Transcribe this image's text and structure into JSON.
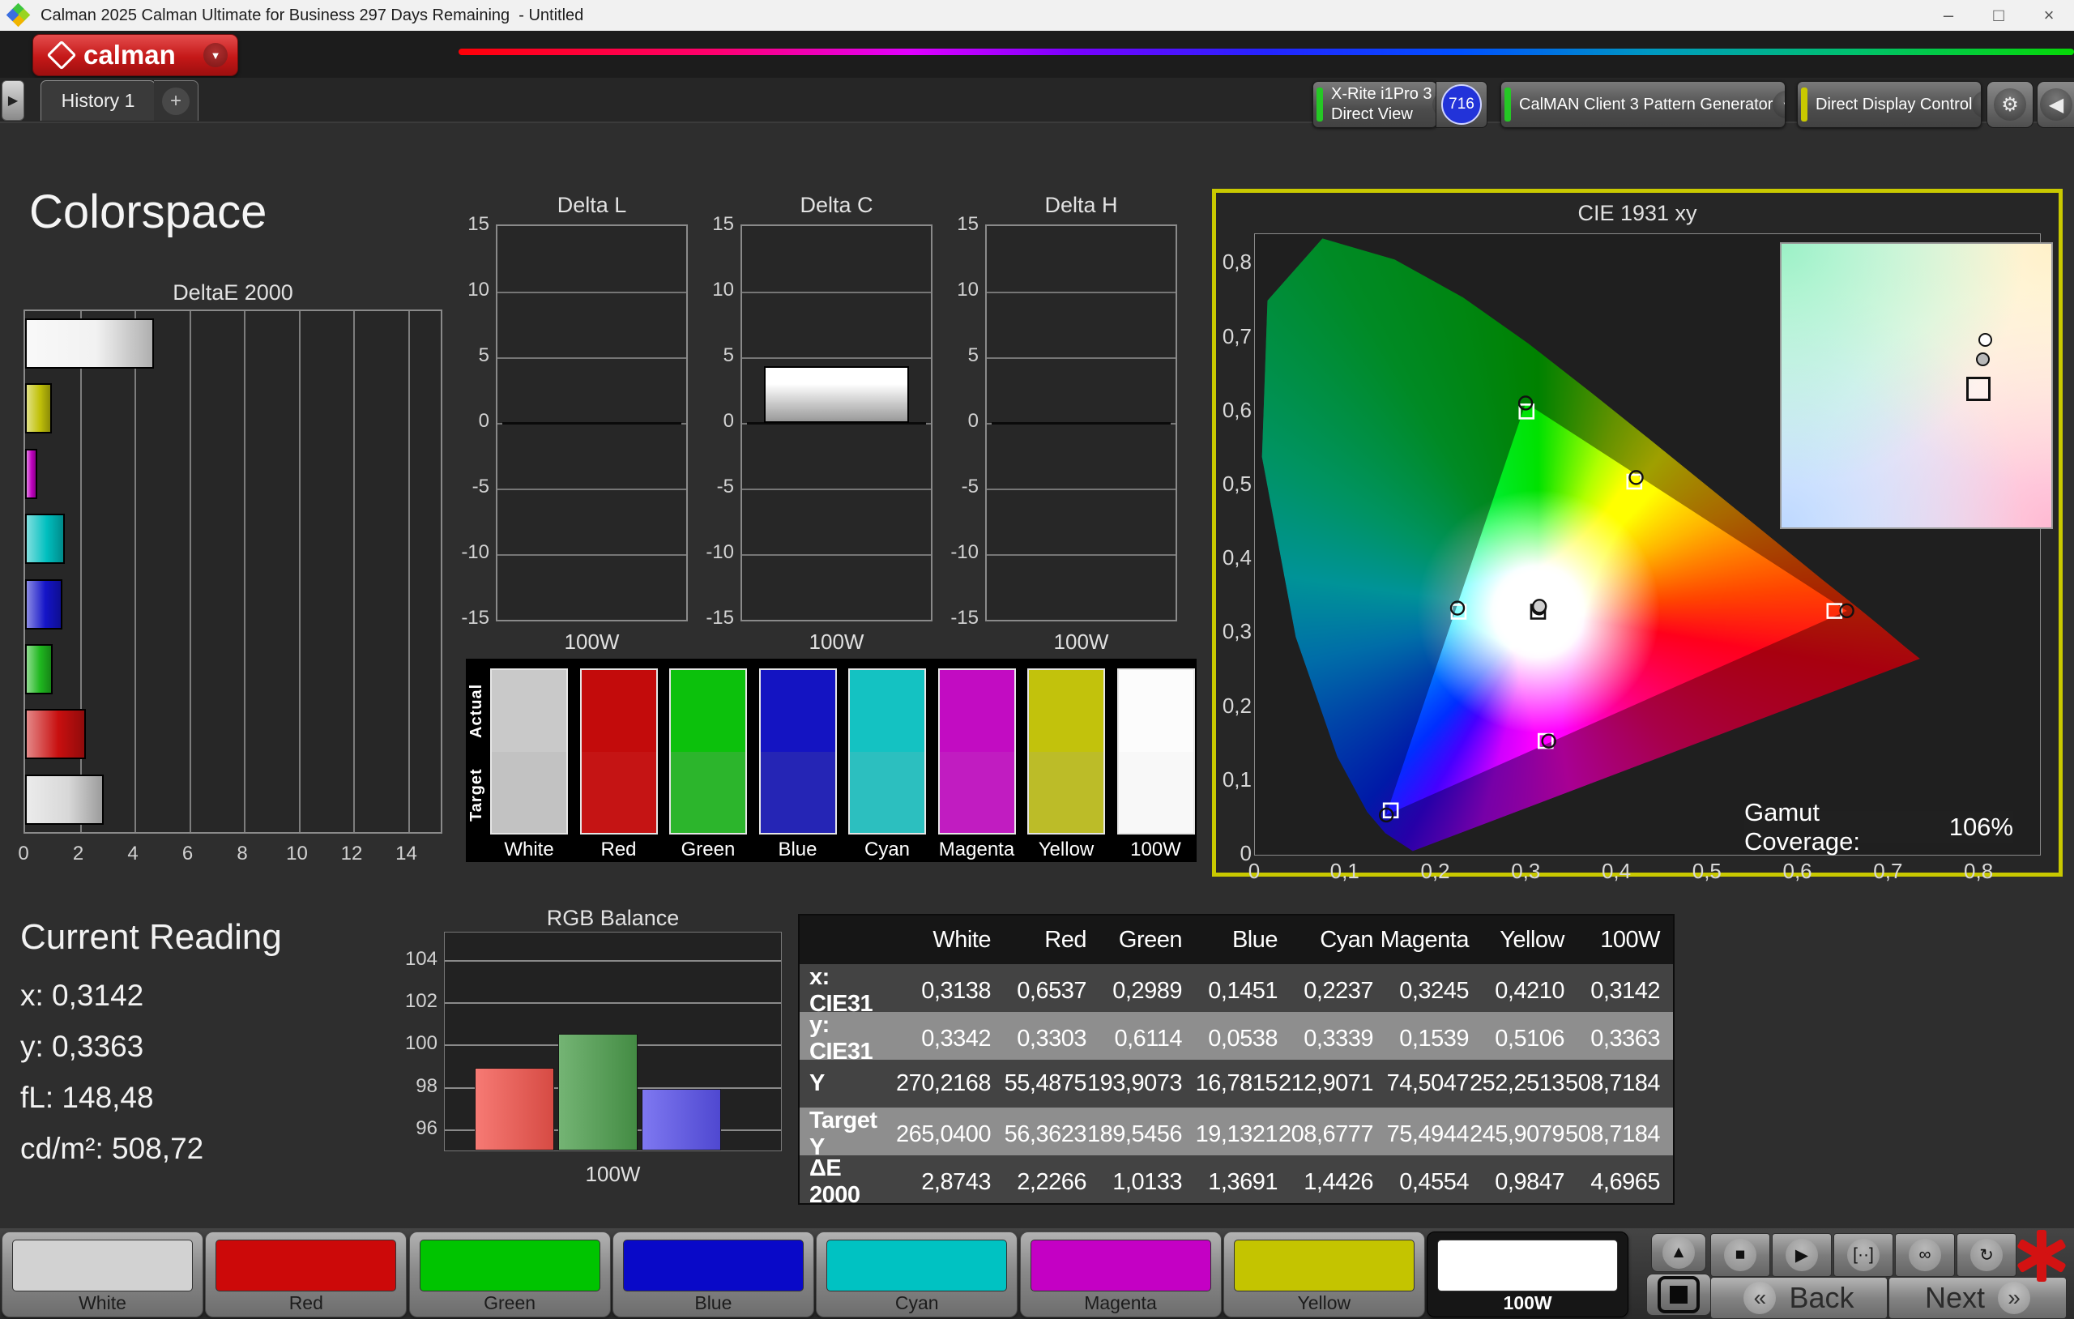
{
  "window": {
    "title": "Calman 2025 Calman Ultimate for Business 297 Days Remaining  - Untitled"
  },
  "icons": {
    "minimize": "–",
    "restore": "□",
    "close": "×",
    "dropdown_arrow": "▼",
    "tab_scroll": "▶",
    "collapse": "◀",
    "gear": "⚙",
    "up": "▲",
    "back_chevrons": "«",
    "next_chevrons": "»",
    "add": "+"
  },
  "brand": {
    "logo_text": "calman"
  },
  "tab_bar": {
    "tab": "History 1"
  },
  "top_controls": {
    "meter": {
      "line1": "X-Rite i1Pro 3",
      "line2": "Direct View",
      "badge": "716",
      "accent": "#25c825"
    },
    "pattern": {
      "label": "CalMAN Client 3 Pattern Generator",
      "accent": "#25c825"
    },
    "display": {
      "label": "Direct Display Control",
      "accent": "#c9c900"
    }
  },
  "page": {
    "title": "Colorspace"
  },
  "current_reading": {
    "heading": "Current Reading",
    "lines": [
      "x: 0,3142",
      "y: 0,3363",
      "fL: 148,48",
      "cd/m²: 508,72"
    ]
  },
  "swatch_panel": {
    "row_labels": [
      "Actual",
      "Target"
    ],
    "columns": [
      {
        "label": "White",
        "actual": "#c9c9c9",
        "target": "#c2c2c2"
      },
      {
        "label": "Red",
        "actual": "#c30b0b",
        "target": "#c51414"
      },
      {
        "label": "Green",
        "actual": "#0cc10c",
        "target": "#2cb52c"
      },
      {
        "label": "Blue",
        "actual": "#1414c2",
        "target": "#2525b5"
      },
      {
        "label": "Cyan",
        "actual": "#14c2c2",
        "target": "#2cbfbf"
      },
      {
        "label": "Magenta",
        "actual": "#c20cc2",
        "target": "#c11cc1"
      },
      {
        "label": "Yellow",
        "actual": "#c2c20c",
        "target": "#bcbc28"
      },
      {
        "label": "100W",
        "actual": "#fcfcfc",
        "target": "#f8f8f8"
      }
    ]
  },
  "table": {
    "columns": [
      "",
      "White",
      "Red",
      "Green",
      "Blue",
      "Cyan",
      "Magenta",
      "Yellow",
      "100W"
    ],
    "rows": [
      {
        "label": "x: CIE31",
        "values": [
          "0,3138",
          "0,6537",
          "0,2989",
          "0,1451",
          "0,2237",
          "0,3245",
          "0,4210",
          "0,3142"
        ]
      },
      {
        "label": "y: CIE31",
        "values": [
          "0,3342",
          "0,3303",
          "0,6114",
          "0,0538",
          "0,3339",
          "0,1539",
          "0,5106",
          "0,3363"
        ]
      },
      {
        "label": "Y",
        "values": [
          "270,2168",
          "55,4875",
          "193,9073",
          "16,7815",
          "212,9071",
          "74,5047",
          "252,2513",
          "508,7184"
        ]
      },
      {
        "label": "Target Y",
        "values": [
          "265,0400",
          "56,3623",
          "189,5456",
          "19,1321",
          "208,6777",
          "75,4944",
          "245,9079",
          "508,7184"
        ]
      },
      {
        "label": "ΔE 2000",
        "values": [
          "2,8743",
          "2,2266",
          "1,0133",
          "1,3691",
          "1,4426",
          "0,4554",
          "0,9847",
          "4,6965"
        ]
      }
    ]
  },
  "pattern_buttons": [
    {
      "label": "White",
      "color": "#d2d2d2",
      "selected": false
    },
    {
      "label": "Red",
      "color": "#cc0909",
      "selected": false
    },
    {
      "label": "Green",
      "color": "#00c400",
      "selected": false
    },
    {
      "label": "Blue",
      "color": "#0909c8",
      "selected": false
    },
    {
      "label": "Cyan",
      "color": "#00c2c2",
      "selected": false
    },
    {
      "label": "Magenta",
      "color": "#c400c4",
      "selected": false
    },
    {
      "label": "Yellow",
      "color": "#c4c400",
      "selected": false
    },
    {
      "label": "100W",
      "color": "#ffffff",
      "selected": true
    }
  ],
  "transport": {
    "back": "Back",
    "next": "Next",
    "icons": [
      {
        "name": "stop",
        "glyph": "■"
      },
      {
        "name": "play",
        "glyph": "▶"
      },
      {
        "name": "range",
        "glyph": "[··]"
      },
      {
        "name": "loop",
        "glyph": "∞"
      },
      {
        "name": "refresh",
        "glyph": "↻"
      }
    ]
  },
  "chart_data": [
    {
      "name": "deltae2000",
      "type": "bar",
      "orientation": "horizontal",
      "title": "DeltaE 2000",
      "categories": [
        "100W",
        "Yellow",
        "Magenta",
        "Cyan",
        "Blue",
        "Green",
        "Red",
        "White"
      ],
      "values": [
        4.6965,
        0.9847,
        0.4554,
        1.4426,
        1.3691,
        1.0133,
        2.2266,
        2.8743
      ],
      "colors": [
        "#f2f2f2",
        "#c2c20a",
        "#bf00bf",
        "#00bfbf",
        "#1414c8",
        "#1fb81f",
        "#c80f0f",
        "#d8d8d8"
      ],
      "xlim": [
        0,
        15.2
      ],
      "x_ticks": [
        "0",
        "2",
        "4",
        "6",
        "8",
        "10",
        "12",
        "14"
      ],
      "grid": true
    },
    {
      "name": "delta_l",
      "type": "bar",
      "title": "Delta L",
      "categories": [
        "100W"
      ],
      "values": [
        0
      ],
      "ylim": [
        -15,
        15
      ],
      "y_ticks": [
        "15",
        "10",
        "5",
        "0",
        "-5",
        "-10",
        "-15"
      ],
      "xlabel": "100W",
      "grid": true
    },
    {
      "name": "delta_c",
      "type": "bar",
      "title": "Delta C",
      "categories": [
        "100W"
      ],
      "values": [
        4.3
      ],
      "bar_color": "#ffffff",
      "ylim": [
        -15,
        15
      ],
      "y_ticks": [
        "15",
        "10",
        "5",
        "0",
        "-5",
        "-10",
        "-15"
      ],
      "xlabel": "100W",
      "grid": true
    },
    {
      "name": "delta_h",
      "type": "bar",
      "title": "Delta H",
      "categories": [
        "100W"
      ],
      "values": [
        0
      ],
      "ylim": [
        -15,
        15
      ],
      "y_ticks": [
        "15",
        "10",
        "5",
        "0",
        "-5",
        "-10",
        "-15"
      ],
      "xlabel": "100W",
      "grid": true
    },
    {
      "name": "rgb_balance",
      "type": "bar",
      "title": "RGB Balance",
      "categories": [
        "Red",
        "Green",
        "Blue"
      ],
      "values": [
        98.9,
        100.5,
        97.9
      ],
      "colors": [
        "#f4554d",
        "#4d9f4d",
        "#5a52ed"
      ],
      "ylim": [
        95,
        105.3
      ],
      "y_ticks": [
        "96",
        "98",
        "100",
        "102",
        "104"
      ],
      "xlabel": "100W",
      "grid": true
    },
    {
      "name": "cie1931",
      "type": "scatter",
      "title": "CIE 1931 xy",
      "xlim": [
        0,
        0.867
      ],
      "ylim": [
        0,
        0.84
      ],
      "x_ticks": [
        "0",
        "0,1",
        "0,2",
        "0,3",
        "0,4",
        "0,5",
        "0,6",
        "0,7",
        "0,8"
      ],
      "y_ticks": [
        "0,8",
        "0,7",
        "0,6",
        "0,5",
        "0,4",
        "0,3",
        "0,2",
        "0,1",
        "0"
      ],
      "gamut_label": "Gamut Coverage:",
      "gamut_value": "106%",
      "gamut_triangle": [
        [
          0.6537,
          0.3303
        ],
        [
          0.2989,
          0.6114
        ],
        [
          0.1451,
          0.0538
        ]
      ],
      "series": [
        {
          "name": "Target",
          "marker": "square",
          "points": [
            {
              "name": "White",
              "x": 0.3127,
              "y": 0.329
            },
            {
              "name": "Red",
              "x": 0.64,
              "y": 0.33
            },
            {
              "name": "Green",
              "x": 0.3,
              "y": 0.6
            },
            {
              "name": "Blue",
              "x": 0.15,
              "y": 0.06
            },
            {
              "name": "Cyan",
              "x": 0.225,
              "y": 0.329
            },
            {
              "name": "Magenta",
              "x": 0.321,
              "y": 0.154
            },
            {
              "name": "Yellow",
              "x": 0.419,
              "y": 0.505
            }
          ]
        },
        {
          "name": "Measured",
          "marker": "circle",
          "points": [
            {
              "name": "White",
              "x": 0.3138,
              "y": 0.3342
            },
            {
              "name": "100W",
              "x": 0.3142,
              "y": 0.3363
            },
            {
              "name": "Red",
              "x": 0.6537,
              "y": 0.3303
            },
            {
              "name": "Green",
              "x": 0.2989,
              "y": 0.6114
            },
            {
              "name": "Blue",
              "x": 0.1451,
              "y": 0.0538
            },
            {
              "name": "Cyan",
              "x": 0.2237,
              "y": 0.3339
            },
            {
              "name": "Magenta",
              "x": 0.3245,
              "y": 0.1539
            },
            {
              "name": "Yellow",
              "x": 0.421,
              "y": 0.5106
            }
          ]
        }
      ]
    }
  ]
}
